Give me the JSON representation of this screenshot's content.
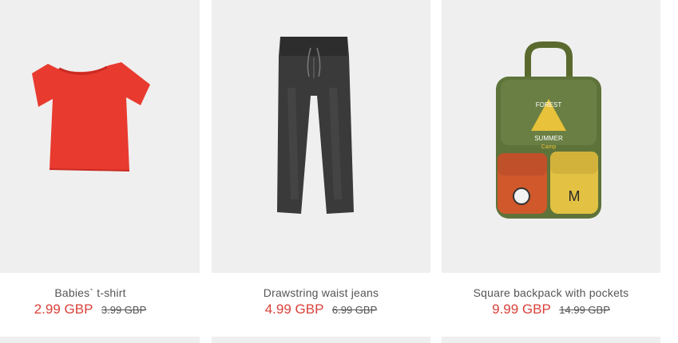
{
  "products": [
    {
      "name": "Babies` t-shirt",
      "price": "2.99 GBP",
      "old_price": "3.99 GBP",
      "image": "red-tshirt-image"
    },
    {
      "name": "Drawstring waist jeans",
      "price": "4.99 GBP",
      "old_price": "6.99 GBP",
      "image": "grey-jeans-image"
    },
    {
      "name": "Square backpack with pockets",
      "price": "9.99 GBP",
      "old_price": "14.99 GBP",
      "image": "green-backpack-image",
      "print_text": [
        "FOREST",
        "SUMMER",
        "Camp"
      ]
    }
  ],
  "colors": {
    "sale_price": "#d9413a",
    "text": "#555555",
    "image_bg": "#efefef"
  }
}
